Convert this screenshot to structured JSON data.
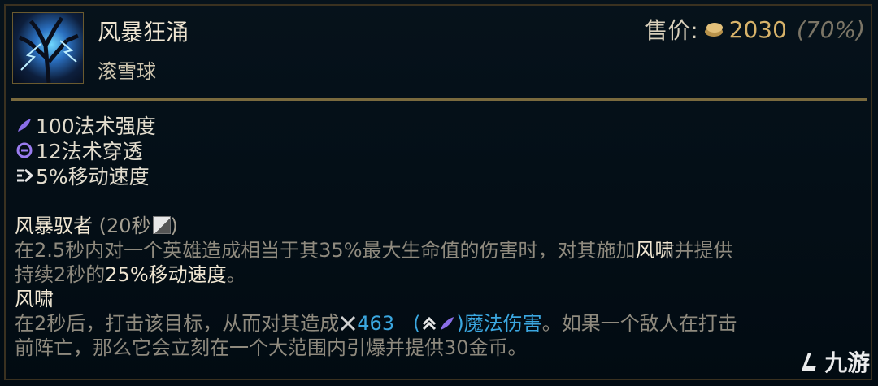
{
  "item": {
    "name": "风暴狂涌",
    "subtitle": "滚雪球",
    "price_label": "售价:",
    "price_value": "2030",
    "price_percent": "(70%)"
  },
  "stats": [
    {
      "icon": "ability-power-icon",
      "text": "100法术强度"
    },
    {
      "icon": "magic-penetration-icon",
      "text": "12法术穿透"
    },
    {
      "icon": "move-speed-icon",
      "text": "5%移动速度"
    }
  ],
  "passive": {
    "name": "风暴驭者",
    "cooldown_open": "(20秒",
    "cooldown_close": ")",
    "desc1_a": "在2.5秒内对一个英雄造成相当于其35%最大生命值的伤害时，对其施加",
    "desc1_b": "风啸",
    "desc1_c": "并提供",
    "desc2_a": "持续2秒的",
    "desc2_b": "25%移动速度",
    "desc2_c": "。",
    "sub_name": "风啸",
    "desc3_a": "在2秒后，打击该目标，从而对其造成",
    "desc3_value": "463",
    "desc3_paren_open": "(",
    "desc3_paren_close": ")",
    "desc3_b": "魔法伤害",
    "desc3_c": "。如果一个敌人在打击",
    "desc4": "前阵亡，那么它会立刻在一个大范围内引爆并提供30金币。"
  },
  "watermark": {
    "text": "九游"
  },
  "colors": {
    "gold": "#d8b36a",
    "blue_highlight": "#3ba7e0",
    "border": "#7a6a3e"
  }
}
